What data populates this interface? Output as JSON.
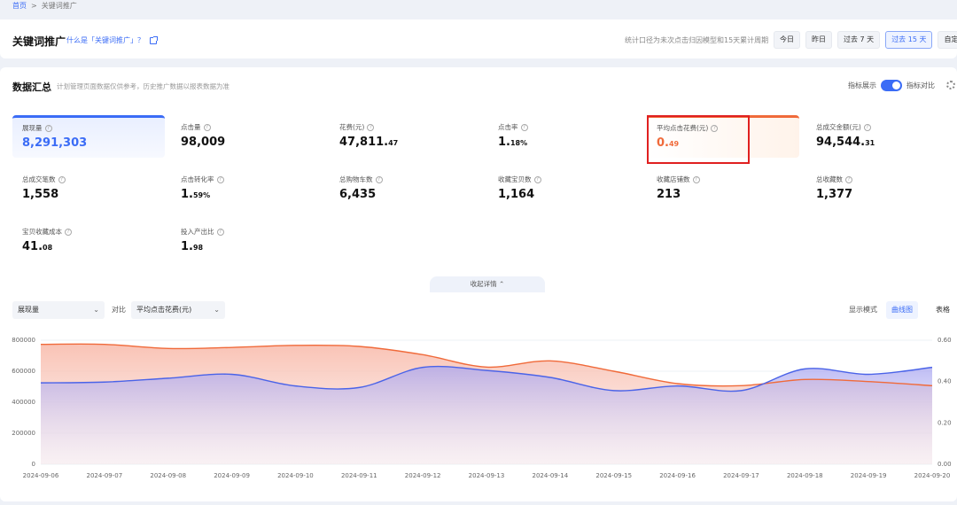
{
  "breadcrumb": {
    "home": "首页",
    "sep": ">",
    "current": "关键词推广"
  },
  "header": {
    "title": "关键词推广",
    "help_link": "什么是「关键词推广」？",
    "note": "统计口径为未次点击归因模型和15天累计周期",
    "ranges": [
      {
        "label": "今日",
        "active": false
      },
      {
        "label": "昨日",
        "active": false
      },
      {
        "label": "过去 7 天",
        "active": false
      },
      {
        "label": "过去 15 天",
        "active": true
      },
      {
        "label": "自定义",
        "active": false
      }
    ]
  },
  "summary": {
    "title": "数据汇总",
    "subtitle": "计划管理页面数据仅供参考，历史推广数据以报表数据为准",
    "indicator_label": "指标展示",
    "compare_label": "指标对比",
    "collapse_label": "收起详情"
  },
  "metrics": [
    {
      "label": "展现量",
      "int": "8,291,303",
      "dec": ""
    },
    {
      "label": "点击量",
      "int": "98,009",
      "dec": ""
    },
    {
      "label": "花费(元)",
      "int": "47,811.",
      "dec": "47"
    },
    {
      "label": "点击率",
      "int": "1.",
      "dec": "18%"
    },
    {
      "label": "平均点击花费(元)",
      "int": "0.",
      "dec": "49"
    },
    {
      "label": "总成交金额(元)",
      "int": "94,544.",
      "dec": "31"
    },
    {
      "label": "总成交笔数",
      "int": "1,558",
      "dec": ""
    },
    {
      "label": "点击转化率",
      "int": "1.",
      "dec": "59%"
    },
    {
      "label": "总购物车数",
      "int": "6,435",
      "dec": ""
    },
    {
      "label": "收藏宝贝数",
      "int": "1,164",
      "dec": ""
    },
    {
      "label": "收藏店铺数",
      "int": "213",
      "dec": ""
    },
    {
      "label": "总收藏数",
      "int": "1,377",
      "dec": ""
    },
    {
      "label": "宝贝收藏成本",
      "int": "41.",
      "dec": "08"
    },
    {
      "label": "投入产出比",
      "int": "1.",
      "dec": "98"
    }
  ],
  "chart_controls": {
    "primary": "展现量",
    "vs_label": "对比",
    "secondary": "平均点击花费(元)",
    "mode_label": "显示模式",
    "mode_curve": "曲线图",
    "mode_table": "表格"
  },
  "chart_data": {
    "type": "area",
    "categories": [
      "2024-09-06",
      "2024-09-07",
      "2024-09-08",
      "2024-09-09",
      "2024-09-10",
      "2024-09-11",
      "2024-09-12",
      "2024-09-13",
      "2024-09-14",
      "2024-09-15",
      "2024-09-16",
      "2024-09-17",
      "2024-09-18",
      "2024-09-19",
      "2024-09-20"
    ],
    "left_ticks": [
      "0",
      "200000",
      "400000",
      "600000",
      "800000"
    ],
    "right_ticks": [
      "0.00",
      "0.20",
      "0.40",
      "0.60"
    ],
    "ylim_left": [
      0,
      800000
    ],
    "ylim_right": [
      0,
      0.6
    ],
    "series": [
      {
        "name": "展现量",
        "axis": "left",
        "color": "#4a63e8",
        "values": [
          525000,
          530000,
          555000,
          580000,
          505000,
          495000,
          625000,
          605000,
          560000,
          475000,
          505000,
          475000,
          615000,
          580000,
          625000
        ]
      },
      {
        "name": "平均点击花费(元)",
        "axis": "right",
        "color": "#f06a3a",
        "values": [
          0.58,
          0.58,
          0.56,
          0.565,
          0.575,
          0.57,
          0.53,
          0.47,
          0.5,
          0.45,
          0.39,
          0.38,
          0.41,
          0.4,
          0.38
        ]
      }
    ]
  },
  "colors": {
    "accent": "#3b6cf6",
    "orange": "#f06a3a",
    "highlight_border": "#e02020"
  }
}
